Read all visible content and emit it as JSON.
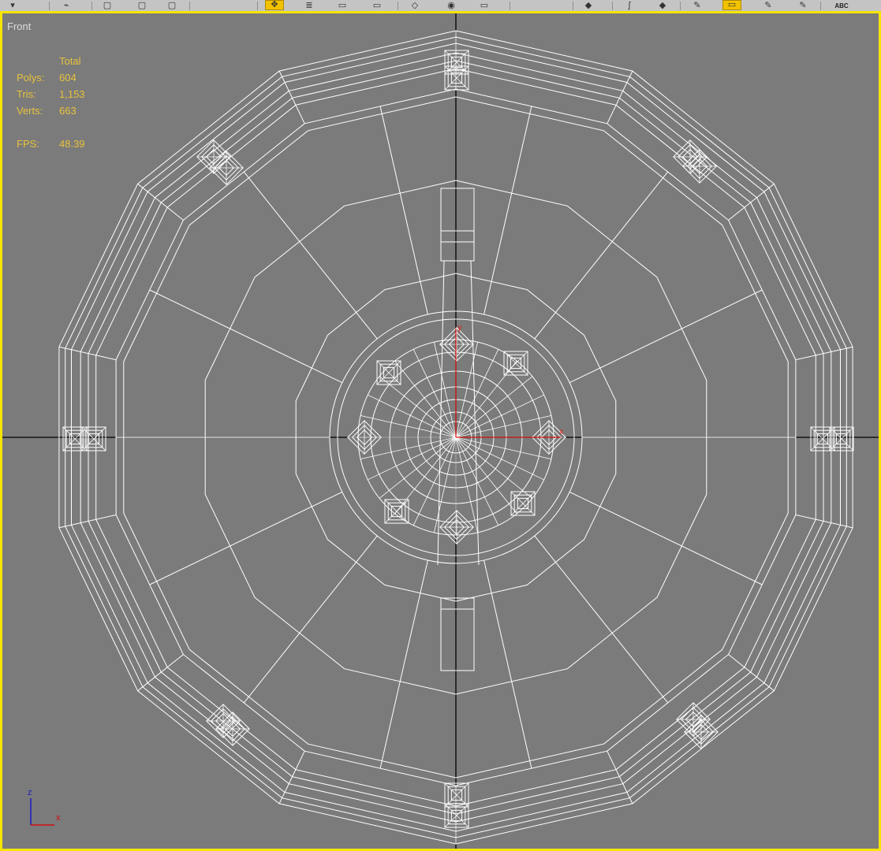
{
  "toolbar": {
    "items": [
      {
        "name": "select-filter-button",
        "glyph": "▾"
      },
      {
        "name": "select-link-button",
        "glyph": "⌁"
      },
      {
        "name": "select-object-button",
        "glyph": "▢"
      },
      {
        "name": "select-by-name-button",
        "glyph": "▢"
      },
      {
        "name": "select-region-button",
        "glyph": "▢"
      },
      {
        "name": "select-and-move-button",
        "glyph": "✥",
        "active": true
      },
      {
        "name": "select-and-rotate-button",
        "glyph": "≣"
      },
      {
        "name": "scale-button",
        "glyph": "▭"
      },
      {
        "name": "reference-system-button",
        "glyph": "▭"
      },
      {
        "name": "mirror-button",
        "glyph": "◇"
      },
      {
        "name": "align-button",
        "glyph": "◉"
      },
      {
        "name": "layer-manager-button",
        "glyph": "▭"
      },
      {
        "name": "curve-editor-button",
        "glyph": "◆"
      },
      {
        "name": "schematic-view-button",
        "glyph": "ʃ"
      },
      {
        "name": "material-editor-button",
        "glyph": "◆"
      },
      {
        "name": "render-setup-button",
        "glyph": "✎"
      },
      {
        "name": "render-frame-button",
        "glyph": "▭",
        "active": true
      },
      {
        "name": "quick-render-button",
        "glyph": "✎"
      },
      {
        "name": "render-last-button",
        "glyph": "✎"
      }
    ],
    "spelling_label": "ABC"
  },
  "viewport": {
    "label": "Front",
    "stats": {
      "header": "Total",
      "rows": [
        {
          "label": "Polys:",
          "value": "604"
        },
        {
          "label": "Tris:",
          "value": "1,153"
        },
        {
          "label": "Verts:",
          "value": "663"
        }
      ],
      "fps_label": "FPS:",
      "fps_value": "48.39"
    },
    "gizmo": {
      "x_label": "x",
      "y_label": "y",
      "x_color": "#e02020",
      "y_color": "#e02020"
    },
    "axis_tripod": {
      "z_label": "z",
      "x_label": "x",
      "z_color": "#2020c0",
      "x_color": "#d01010"
    },
    "colors": {
      "wire": "#ffffff",
      "grid_axis": "#000000",
      "background": "#7b7b7b",
      "active_border": "#f5e500",
      "stats_text": "#e8c23c"
    }
  }
}
